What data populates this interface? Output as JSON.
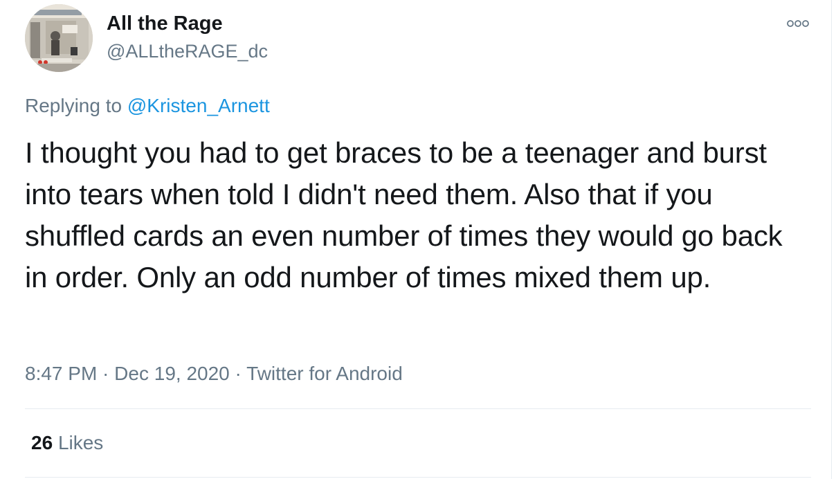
{
  "author": {
    "display_name": "All the Rage",
    "handle": "@ALLtheRAGE_dc",
    "avatar_icon": "truck-photo-avatar"
  },
  "more_icon": "more-options-icon",
  "reply": {
    "prefix": "Replying to ",
    "mention": "@Kristen_Arnett"
  },
  "tweet": {
    "text": "I thought you had to get braces to be a teenager and burst into tears when told I didn't need them. Also that if you shuffled cards an even number of times they would go back in order. Only an odd number of times mixed them up."
  },
  "meta": {
    "time": "8:47 PM",
    "sep1": " · ",
    "date": "Dec 19, 2020",
    "sep2": " · ",
    "source": "Twitter for Android"
  },
  "stats": {
    "likes_count": "26",
    "likes_label": "Likes"
  },
  "colors": {
    "text": "#14171a",
    "secondary": "#657786",
    "link": "#1b95e0",
    "divider": "#e6ecf0"
  }
}
